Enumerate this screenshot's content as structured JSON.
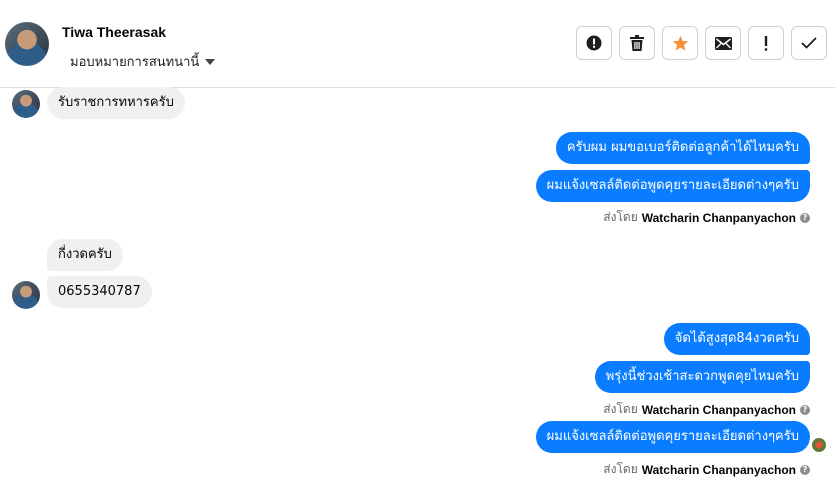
{
  "header": {
    "contact_name": "Tiwa Theerasak",
    "assign_label": "มอบหมายการสนทนานี้"
  },
  "toolbar": {
    "buttons": [
      {
        "name": "spam",
        "icon": "exclamation-circle-icon"
      },
      {
        "name": "delete",
        "icon": "trash-icon"
      },
      {
        "name": "star",
        "icon": "star-icon"
      },
      {
        "name": "mark-unread",
        "icon": "envelope-icon"
      },
      {
        "name": "important",
        "icon": "exclamation-icon"
      },
      {
        "name": "done",
        "icon": "check-icon"
      }
    ],
    "star_color": "#f7923b"
  },
  "messages": [
    {
      "direction": "in",
      "text": "รับราชการทหารครับ"
    },
    {
      "direction": "out",
      "text": "ครับผม ผมขอเบอร์ติดต่อลูกค้าได้ไหมครับ"
    },
    {
      "direction": "out",
      "text": "ผมแจ้งเซลล์ติดต่อพูดคุยรายละเอียดต่างๆครับ"
    },
    {
      "direction": "in",
      "text": "กี่งวดครับ"
    },
    {
      "direction": "in",
      "text": "0655340787"
    },
    {
      "direction": "out",
      "text": "จัดได้สูงสุด84งวดครับ"
    },
    {
      "direction": "out",
      "text": "พรุ่งนี้ช่วงเช้าสะดวกพูดคุยไหมครับ"
    },
    {
      "direction": "out",
      "text": "ผมแจ้งเซลล์ติดต่อพูดคุยรายละเอียดต่างๆครับ"
    }
  ],
  "sent_by": {
    "prefix": "ส่งโดย",
    "name": "Watcharin Chanpanyachon"
  },
  "colors": {
    "outgoing_bubble": "#0a7cff",
    "incoming_bubble": "#f0f0f0"
  }
}
